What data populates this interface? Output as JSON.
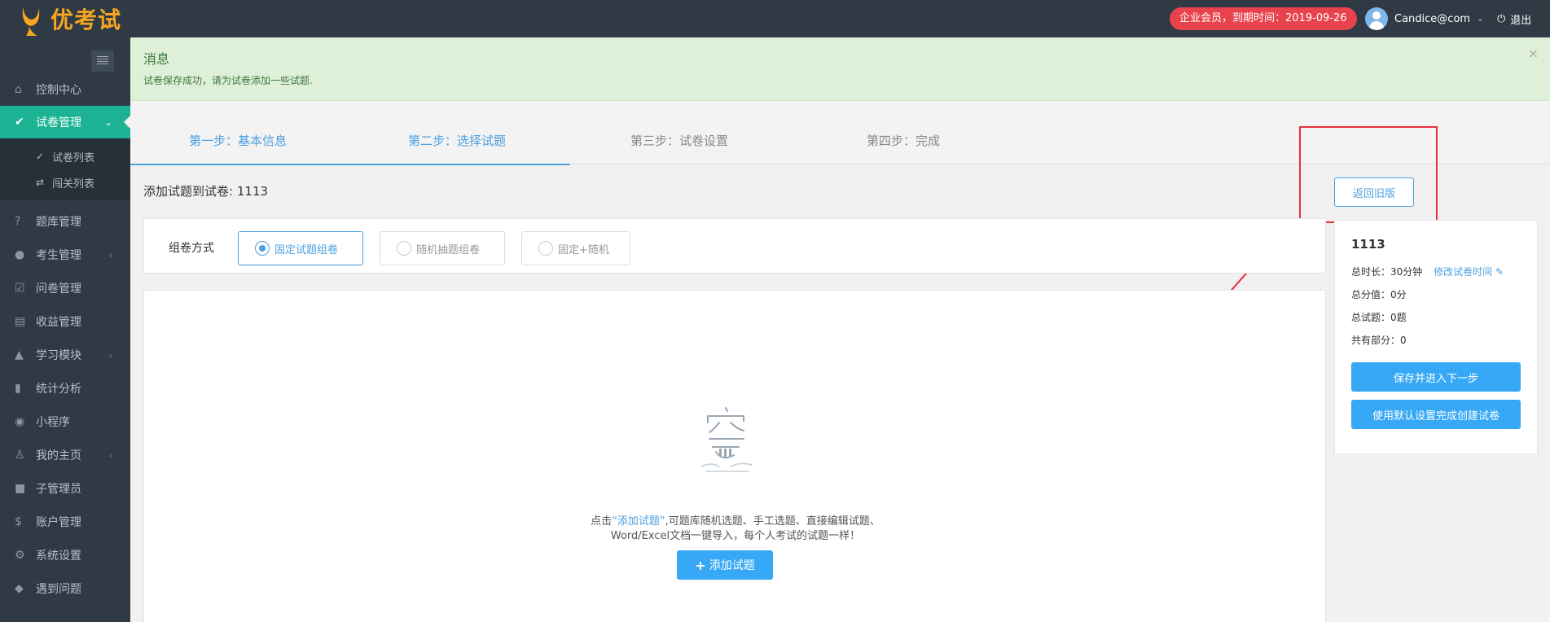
{
  "app": {
    "brand": "优考试"
  },
  "header": {
    "vip_badge": "企业会员，到期时间：2019-09-26",
    "user_name": "Candice@com",
    "logout_label": "退出"
  },
  "sidebar": {
    "items": [
      {
        "label": "控制中心",
        "icon": "home-icon"
      },
      {
        "label": "试卷管理",
        "icon": "check-circle-icon",
        "active": true
      },
      {
        "label": "题库管理",
        "icon": "question-icon"
      },
      {
        "label": "考生管理",
        "icon": "user-icon"
      },
      {
        "label": "问卷管理",
        "icon": "checkbox-icon"
      },
      {
        "label": "收益管理",
        "icon": "card-icon"
      },
      {
        "label": "学习模块",
        "icon": "graduation-icon"
      },
      {
        "label": "统计分析",
        "icon": "bar-chart-icon"
      },
      {
        "label": "小程序",
        "icon": "wechat-icon"
      },
      {
        "label": "我的主页",
        "icon": "person-icon"
      },
      {
        "label": "子管理员",
        "icon": "lock-icon"
      },
      {
        "label": "账户管理",
        "icon": "dollar-icon"
      },
      {
        "label": "系统设置",
        "icon": "gear-icon"
      },
      {
        "label": "遇到问题",
        "icon": "tag-icon"
      }
    ],
    "sub_items": [
      {
        "label": "试卷列表",
        "icon": "check-circle-icon"
      },
      {
        "label": "闯关列表",
        "icon": "shuffle-icon"
      }
    ]
  },
  "alert": {
    "title": "消息",
    "message": "试卷保存成功，请为试卷添加一些试题."
  },
  "steps": [
    {
      "label": "第一步：基本信息",
      "state": "done"
    },
    {
      "label": "第二步：选择试题",
      "state": "current"
    },
    {
      "label": "第三步：试卷设置",
      "state": "todo"
    },
    {
      "label": "第四步：完成",
      "state": "todo"
    }
  ],
  "page": {
    "heading": "添加试题到试卷: 1113",
    "back_old_label": "返回旧版"
  },
  "compose": {
    "label": "组卷方式",
    "options": [
      {
        "label": "固定试题组卷",
        "selected": true
      },
      {
        "label": "随机抽题组卷",
        "selected": false
      },
      {
        "label": "固定+随机",
        "selected": false
      }
    ]
  },
  "empty": {
    "hint_prefix": "点击",
    "hint_link": "“添加试题”",
    "hint_suffix": ",可题库随机选题、手工选题、直接编辑试题、",
    "hint_line2": "Word/Excel文档一键导入，每个人考试的试题一样！",
    "add_label": "添加试题"
  },
  "summary": {
    "title": "1113",
    "duration_label": "总时长：",
    "duration_value": "30分钟",
    "edit_time_label": "修改试卷时间",
    "score_label": "总分值：",
    "score_value": "0分",
    "count_label": "总试题：",
    "count_value": "0题",
    "parts_label": "共有部分：",
    "parts_value": "0",
    "save_next_label": "保存并进入下一步",
    "default_create_label": "使用默认设置完成创建试卷"
  },
  "colors": {
    "sidebar_bg": "#2f3a45",
    "active_green": "#1bb394",
    "accent_blue": "#36a8f5",
    "badge_red": "#e8424d",
    "annotation_red": "#e8303a"
  }
}
